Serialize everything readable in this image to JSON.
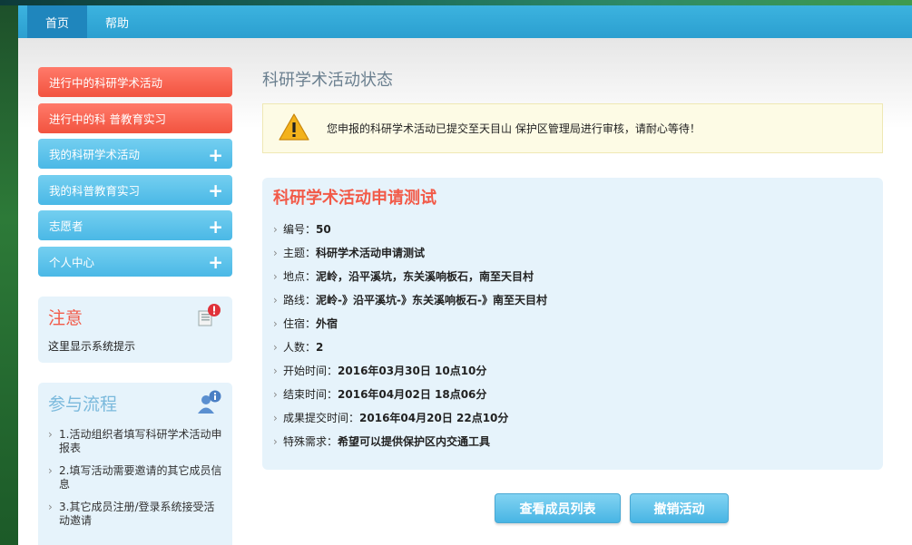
{
  "topnav": [
    {
      "label": "首页",
      "active": true
    },
    {
      "label": "帮助",
      "active": false
    }
  ],
  "sidebar": {
    "items": [
      {
        "label": "进行中的科研学术活动",
        "color": "red",
        "expandable": false
      },
      {
        "label": "进行中的科 普教育实习",
        "color": "red",
        "expandable": false
      },
      {
        "label": "我的科研学术活动",
        "color": "blue",
        "expandable": true
      },
      {
        "label": "我的科普教育实习",
        "color": "blue",
        "expandable": true
      },
      {
        "label": "志愿者",
        "color": "blue",
        "expandable": true
      },
      {
        "label": "个人中心",
        "color": "blue",
        "expandable": true
      }
    ],
    "plus": "+"
  },
  "notice": {
    "title": "注意",
    "text": "这里显示系统提示",
    "icon": "document-alert-icon"
  },
  "process": {
    "title": "参与流程",
    "icon": "user-info-icon",
    "steps": [
      "1.活动组织者填写科研学术活动申报表",
      "2.填写活动需要邀请的其它成员信息",
      "3.其它成员注册/登录系统接受活动邀请"
    ]
  },
  "main": {
    "status_title": "科研学术活动状态",
    "alert": {
      "icon": "warning-icon",
      "text": "您申报的科研学术活动已提交至天目山 保护区管理局进行审核，请耐心等待！"
    },
    "card": {
      "title": "科研学术活动申请测试",
      "fields": [
        {
          "label": "编号：",
          "value": "50"
        },
        {
          "label": "主题：",
          "value": "科研学术活动申请测试"
        },
        {
          "label": "地点：",
          "value": "泥岭，沿平溪坑，东关溪响板石，南至天目村"
        },
        {
          "label": "路线：",
          "value": "泥岭-》沿平溪坑-》东关溪响板石-》南至天目村"
        },
        {
          "label": "住宿：",
          "value": "外宿"
        },
        {
          "label": "人数：",
          "value": "2"
        },
        {
          "label": "开始时间：",
          "value": "2016年03月30日 10点10分"
        },
        {
          "label": "结束时间：",
          "value": "2016年04月02日 18点06分"
        },
        {
          "label": "成果提交时间：",
          "value": "2016年04月20日 22点10分"
        },
        {
          "label": "特殊需求：",
          "value": "希望可以提供保护区内交通工具"
        }
      ]
    },
    "buttons": {
      "members": "查看成员列表",
      "cancel": "撤销活动"
    }
  },
  "colors": {
    "topbar": "#2b9fd0",
    "red_menu": "#f2533f",
    "blue_menu": "#4ab8e6",
    "card_bg": "#e6f3fb",
    "title_red": "#f25a48"
  }
}
